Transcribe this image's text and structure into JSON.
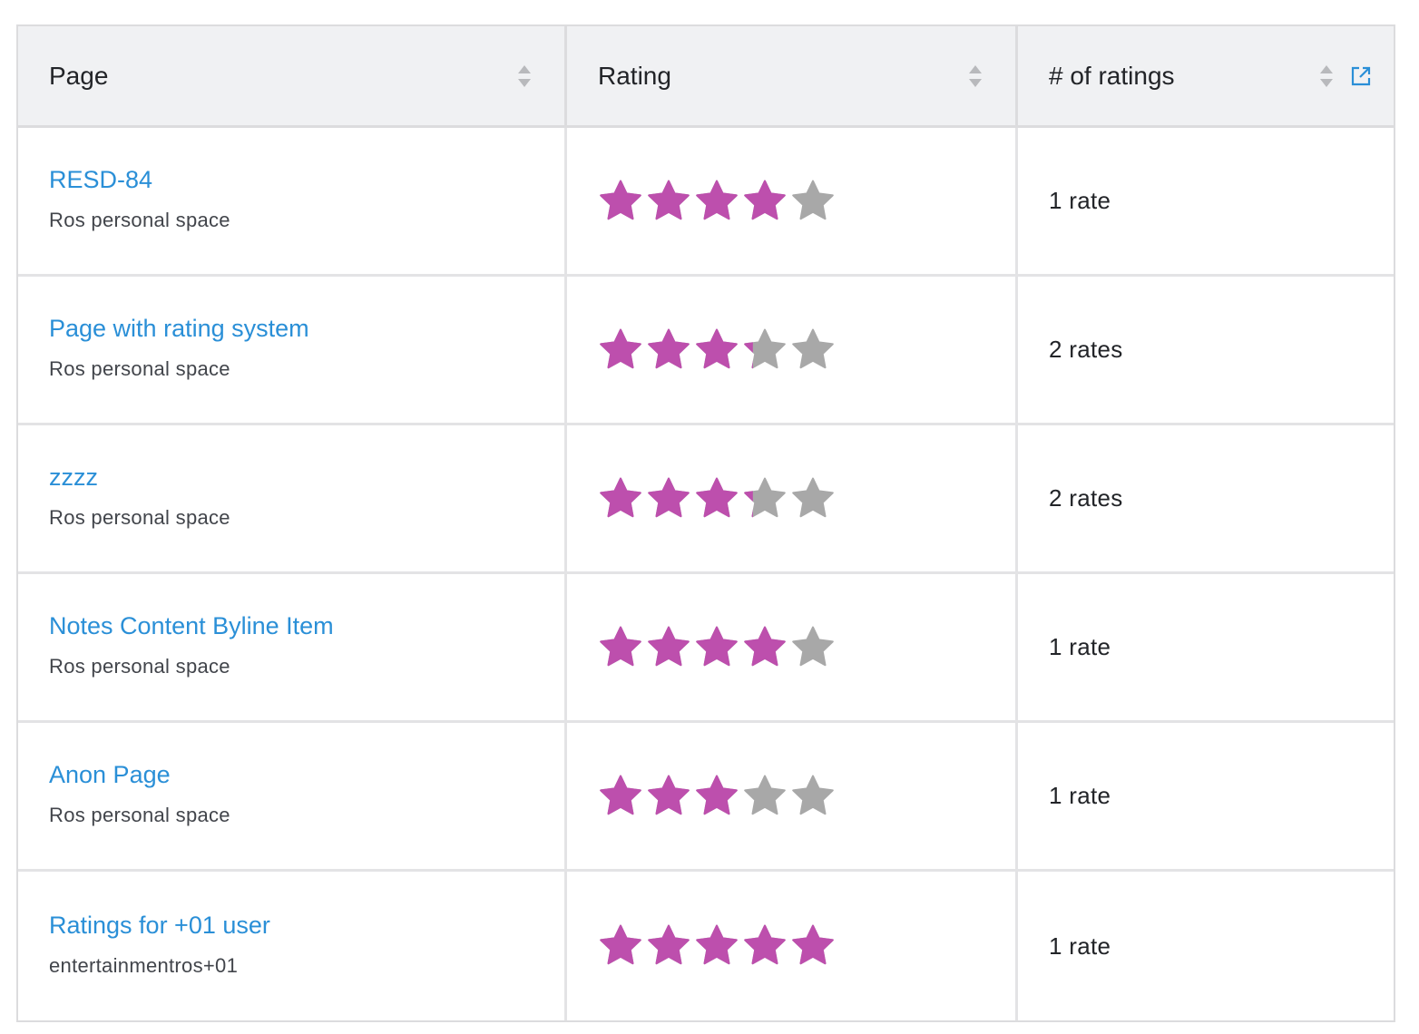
{
  "table": {
    "columns": [
      {
        "label": "Page"
      },
      {
        "label": "Rating"
      },
      {
        "label": "# of ratings"
      }
    ],
    "colors": {
      "star_filled": "#bd4fad",
      "star_empty": "#a8a8a8",
      "link": "#2a8fd7"
    },
    "rows": [
      {
        "title": "RESD-84",
        "space": "Ros personal space",
        "rating": 4,
        "count": "1 rate"
      },
      {
        "title": "Page with rating system",
        "space": "Ros personal space",
        "rating": 3.2,
        "count": "2 rates"
      },
      {
        "title": "zzzz",
        "space": "Ros personal space",
        "rating": 3.2,
        "count": "2 rates"
      },
      {
        "title": "Notes Content Byline Item",
        "space": "Ros personal space",
        "rating": 4,
        "count": "1 rate"
      },
      {
        "title": "Anon Page",
        "space": "Ros personal space",
        "rating": 3,
        "count": "1 rate"
      },
      {
        "title": "Ratings for +01 user",
        "space": "entertainmentros+01",
        "rating": 5,
        "count": "1 rate"
      }
    ]
  }
}
